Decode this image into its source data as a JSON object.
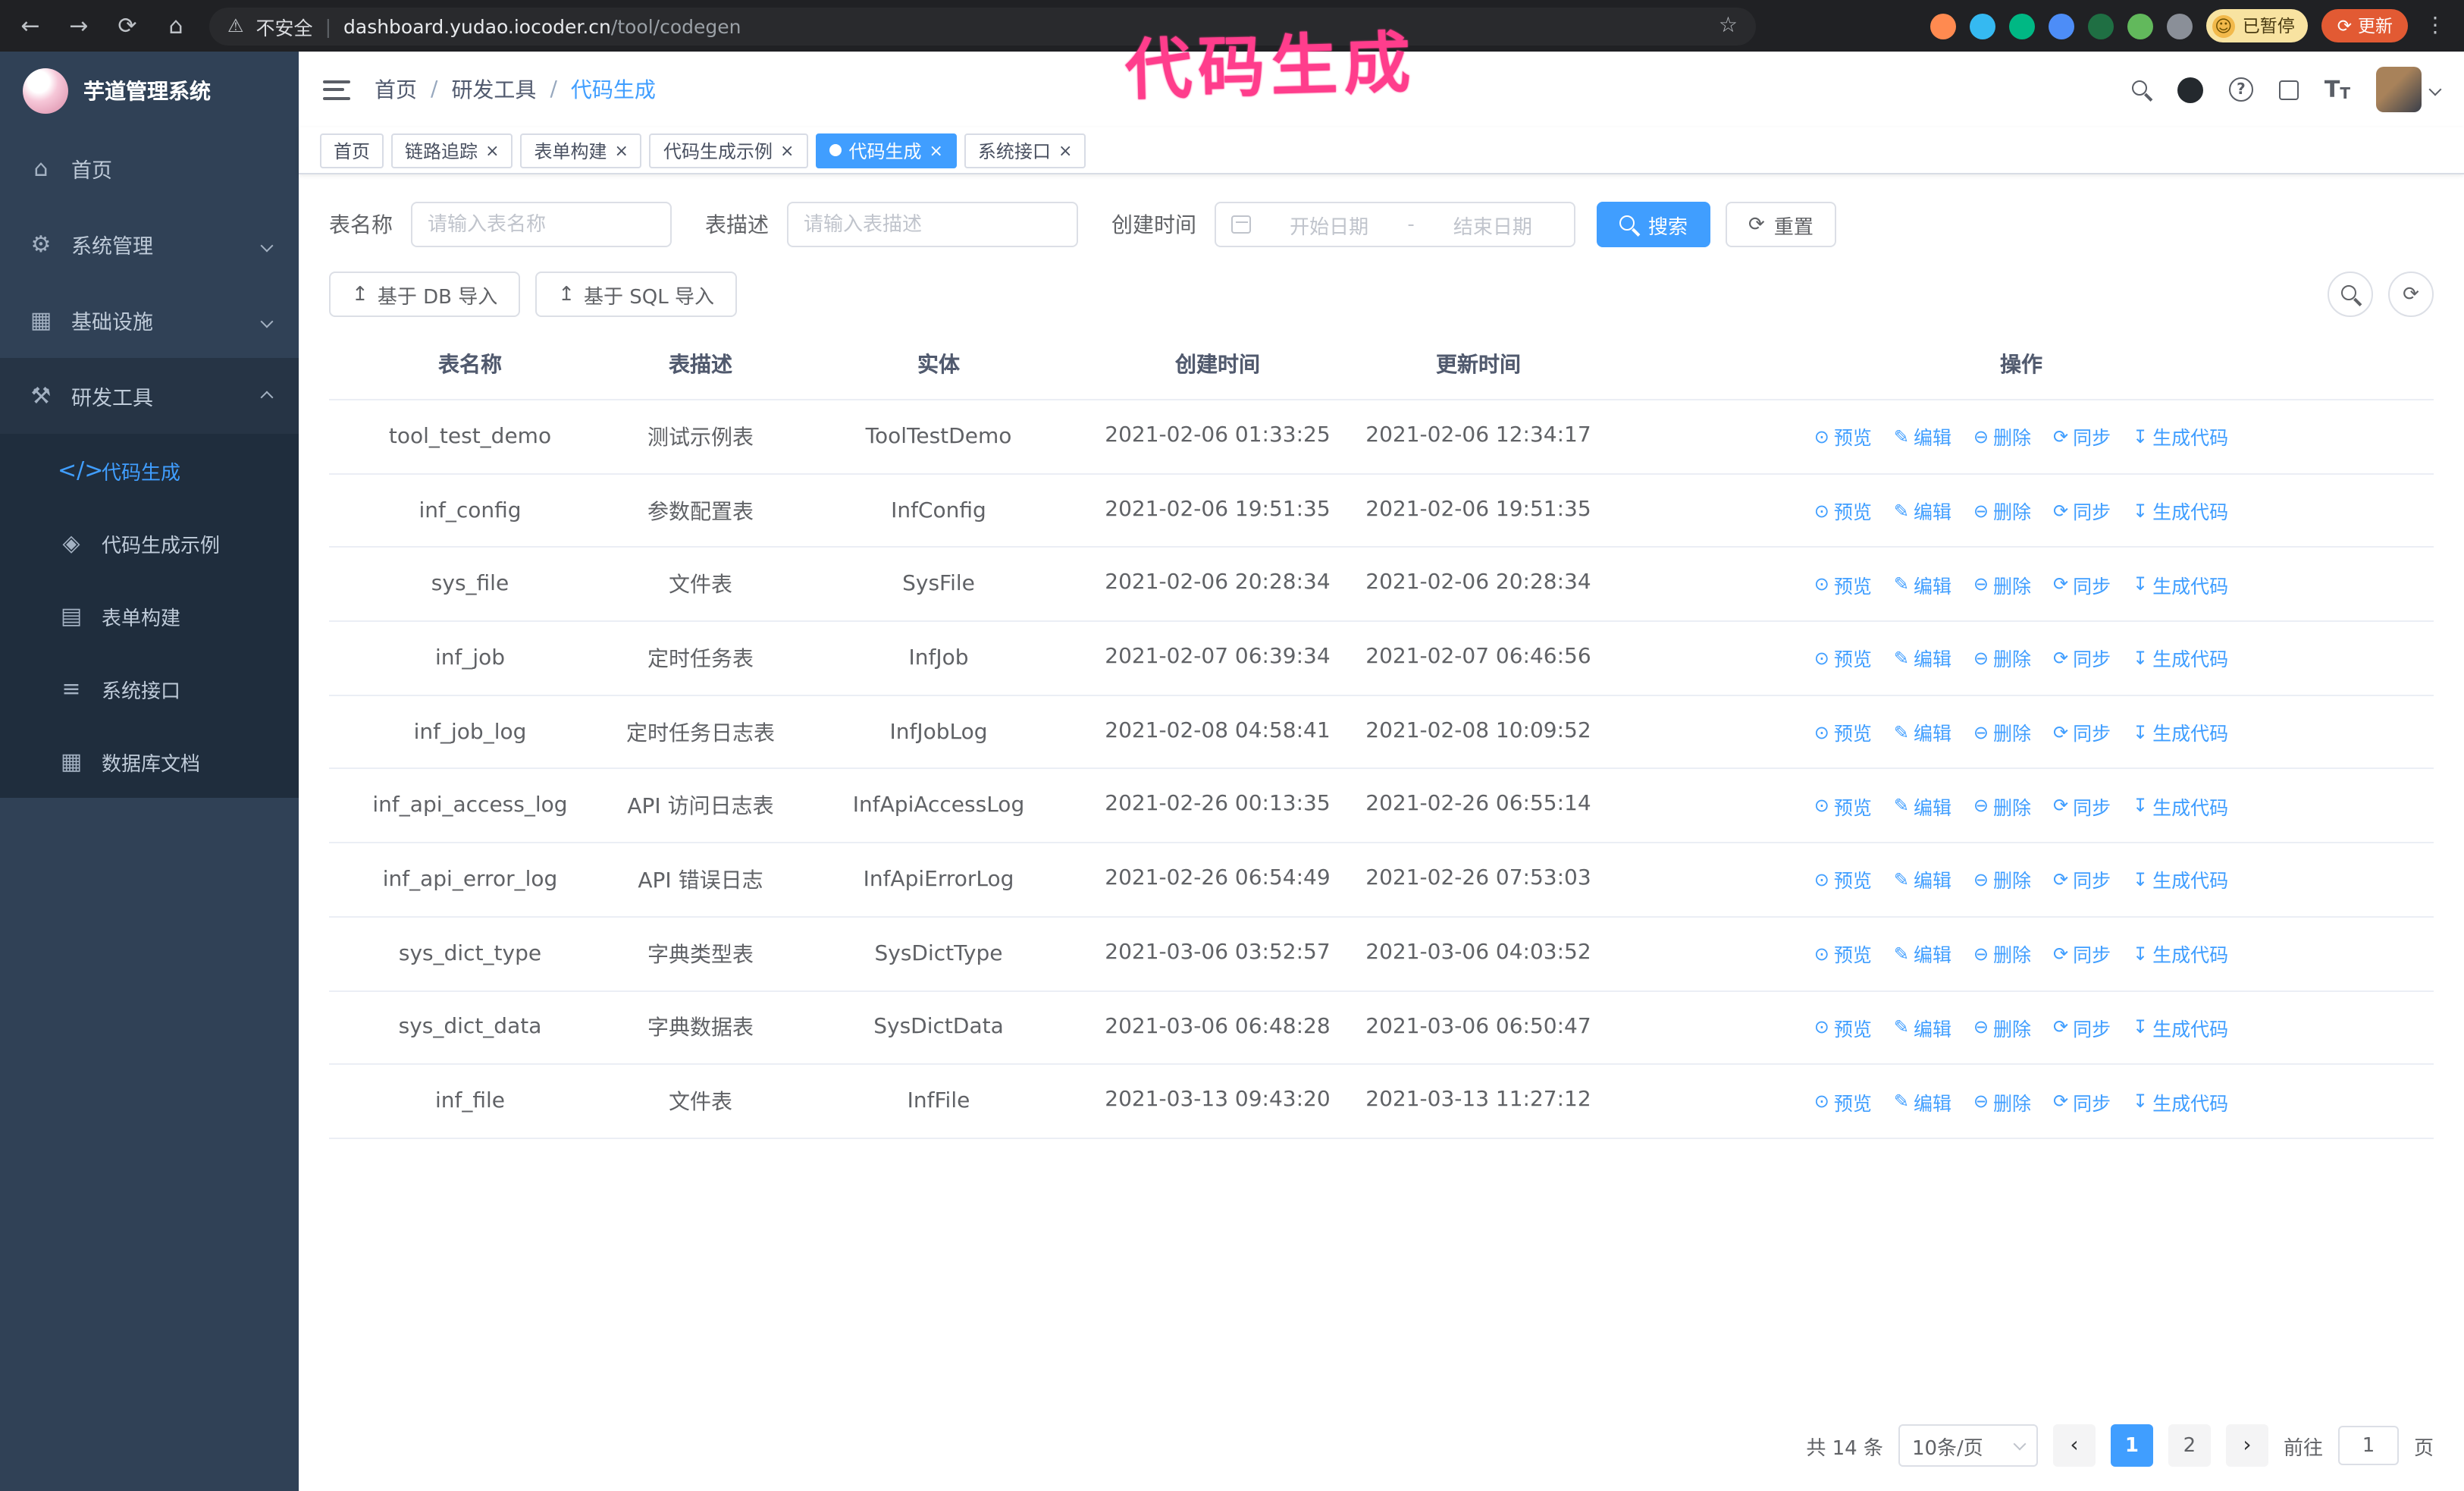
{
  "browser": {
    "insecure_label": "不安全",
    "url_host": "dashboard.yudao.iocoder.cn",
    "url_path": "/tool/codegen",
    "paused_badge": "已暂停",
    "update_button": "更新"
  },
  "annotation": {
    "text": "代码生成",
    "color": "#ff3d8c"
  },
  "sidebar": {
    "logo_title": "芋道管理系统",
    "items": [
      {
        "label": "首页"
      },
      {
        "label": "系统管理"
      },
      {
        "label": "基础设施"
      },
      {
        "label": "研发工具"
      }
    ],
    "submenu": [
      {
        "label": "代码生成"
      },
      {
        "label": "代码生成示例"
      },
      {
        "label": "表单构建"
      },
      {
        "label": "系统接口"
      },
      {
        "label": "数据库文档"
      }
    ]
  },
  "header": {
    "breadcrumb": [
      "首页",
      "研发工具",
      "代码生成"
    ],
    "separator": "/"
  },
  "tabs": [
    {
      "label": "首页"
    },
    {
      "label": "链路追踪"
    },
    {
      "label": "表单构建"
    },
    {
      "label": "代码生成示例"
    },
    {
      "label": "代码生成"
    },
    {
      "label": "系统接口"
    }
  ],
  "filters": {
    "table_name_label": "表名称",
    "table_name_placeholder": "请输入表名称",
    "table_desc_label": "表描述",
    "table_desc_placeholder": "请输入表描述",
    "create_time_label": "创建时间",
    "date_start_placeholder": "开始日期",
    "date_separator": "-",
    "date_end_placeholder": "结束日期",
    "search_button": "搜索",
    "reset_button": "重置"
  },
  "toolbar": {
    "import_db": "基于 DB 导入",
    "import_sql": "基于 SQL 导入"
  },
  "table": {
    "columns": [
      "表名称",
      "表描述",
      "实体",
      "创建时间",
      "更新时间",
      "操作"
    ],
    "ops": {
      "preview": "预览",
      "edit": "编辑",
      "delete": "删除",
      "sync": "同步",
      "generate": "生成代码"
    },
    "rows": [
      {
        "name": "tool_test_demo",
        "desc": "测试示例表",
        "entity": "ToolTestDemo",
        "created": "2021-02-06 01:33:25",
        "updated": "2021-02-06 12:34:17"
      },
      {
        "name": "inf_config",
        "desc": "参数配置表",
        "entity": "InfConfig",
        "created": "2021-02-06 19:51:35",
        "updated": "2021-02-06 19:51:35"
      },
      {
        "name": "sys_file",
        "desc": "文件表",
        "entity": "SysFile",
        "created": "2021-02-06 20:28:34",
        "updated": "2021-02-06 20:28:34"
      },
      {
        "name": "inf_job",
        "desc": "定时任务表",
        "entity": "InfJob",
        "created": "2021-02-07 06:39:34",
        "updated": "2021-02-07 06:46:56"
      },
      {
        "name": "inf_job_log",
        "desc": "定时任务日志表",
        "entity": "InfJobLog",
        "created": "2021-02-08 04:58:41",
        "updated": "2021-02-08 10:09:52"
      },
      {
        "name": "inf_api_access_log",
        "desc": "API 访问日志表",
        "entity": "InfApiAccessLog",
        "created": "2021-02-26 00:13:35",
        "updated": "2021-02-26 06:55:14"
      },
      {
        "name": "inf_api_error_log",
        "desc": "API 错误日志",
        "entity": "InfApiErrorLog",
        "created": "2021-02-26 06:54:49",
        "updated": "2021-02-26 07:53:03"
      },
      {
        "name": "sys_dict_type",
        "desc": "字典类型表",
        "entity": "SysDictType",
        "created": "2021-03-06 03:52:57",
        "updated": "2021-03-06 04:03:52"
      },
      {
        "name": "sys_dict_data",
        "desc": "字典数据表",
        "entity": "SysDictData",
        "created": "2021-03-06 06:48:28",
        "updated": "2021-03-06 06:50:47"
      },
      {
        "name": "inf_file",
        "desc": "文件表",
        "entity": "InfFile",
        "created": "2021-03-13 09:43:20",
        "updated": "2021-03-13 11:27:12"
      }
    ]
  },
  "pagination": {
    "total": "共 14 条",
    "page_size": "10条/页",
    "pages": [
      "1",
      "2"
    ],
    "active_page": "1",
    "goto_label": "前往",
    "goto_value": "1",
    "goto_suffix": "页"
  },
  "icons": {
    "back": "←",
    "forward": "→",
    "reload": "⟳",
    "home": "⌂",
    "warning": "⚠",
    "star": "☆",
    "kebab": "⋮",
    "smile": "☺",
    "update": "⟳",
    "menu_home": "⌂",
    "menu_system": "⚙",
    "menu_infra": "▦",
    "menu_dev": "⚒",
    "sub_codegen": "</>",
    "sub_example": "◈",
    "sub_form": "▤",
    "sub_api": "≡",
    "sub_db": "▦",
    "upload": "↥",
    "question": "?",
    "font_big": "T",
    "font_small": "T",
    "eye": "⊙",
    "edit": "✎",
    "delete": "⊖",
    "sync": "⟳",
    "generate": "↧",
    "close": "×",
    "prev": "‹",
    "next": "›"
  },
  "colors": {
    "accent": "#409eff",
    "sidebar_bg": "#304156",
    "submenu_bg": "#1f2d3d",
    "annotation": "#ff3d8c",
    "chrome_bg": "#202124",
    "update_button": "#e25a33",
    "paused_chip": "#f8e3a1",
    "input_border": "#dcdfe6",
    "table_border": "#ebeef5",
    "pager_bg": "#f4f4f5"
  }
}
